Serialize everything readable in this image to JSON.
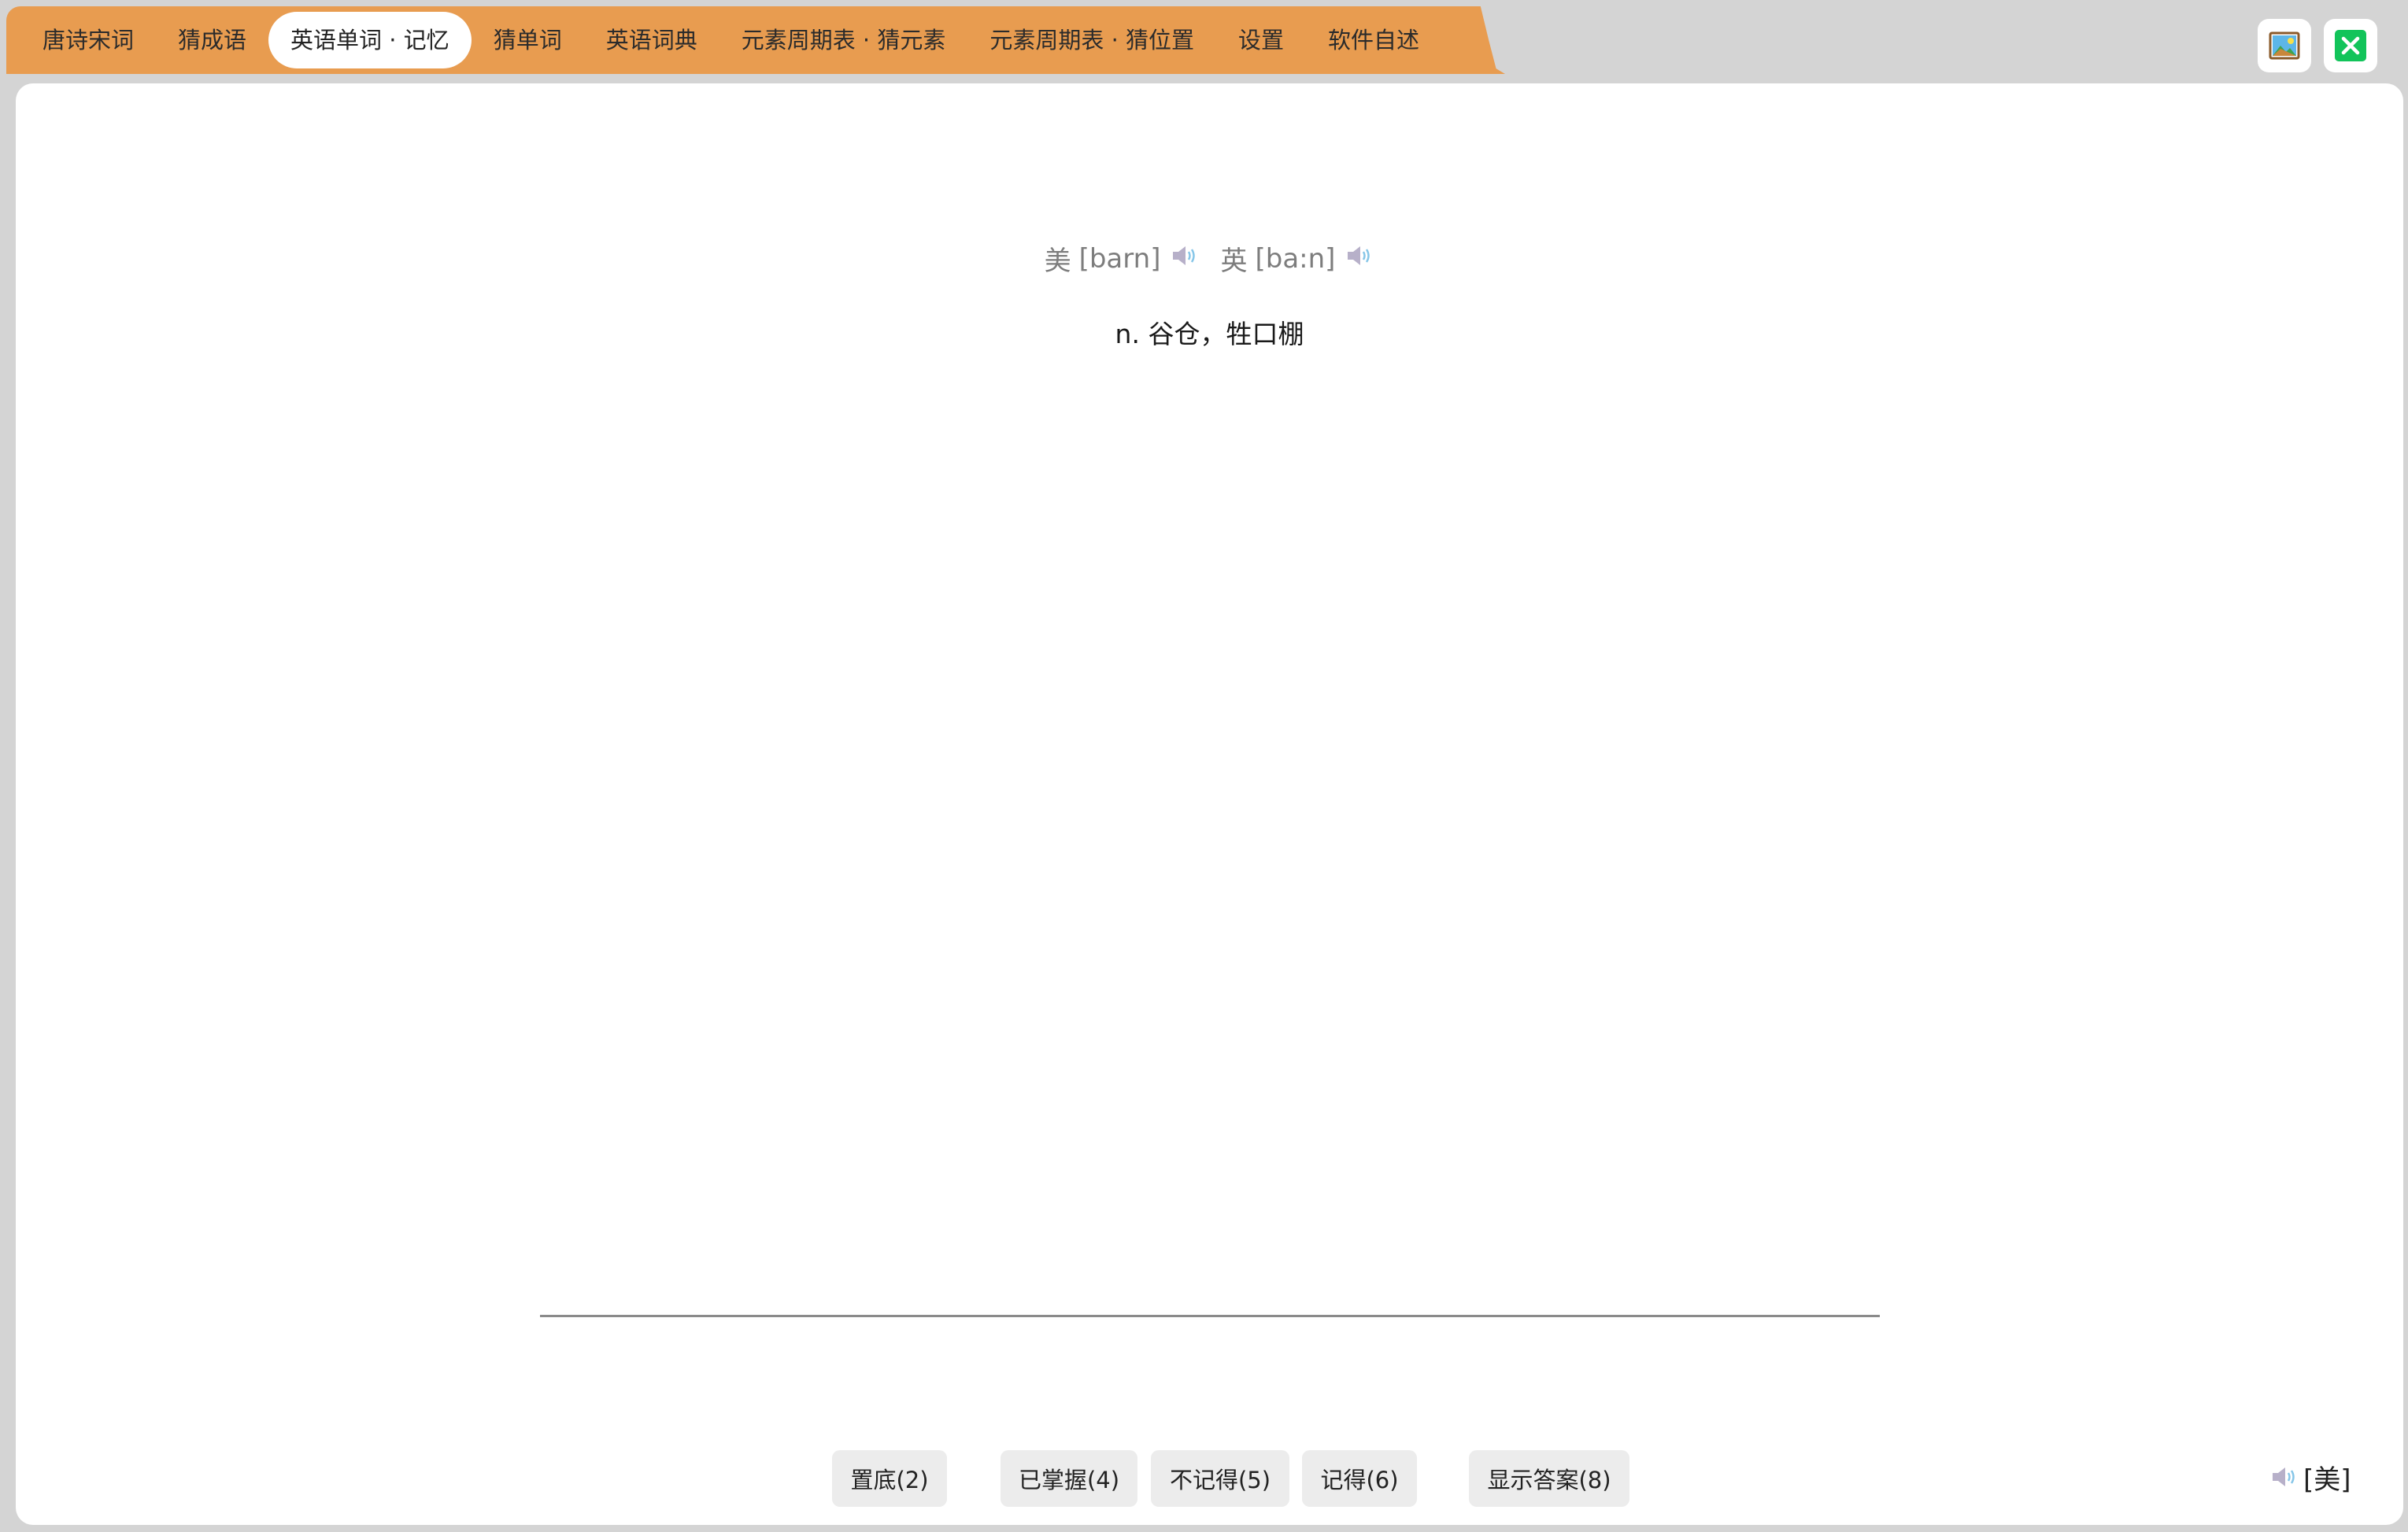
{
  "tabs": [
    {
      "label": "唐诗宋词",
      "active": false
    },
    {
      "label": "猜成语",
      "active": false
    },
    {
      "label": "英语单词 · 记忆",
      "active": true
    },
    {
      "label": "猜单词",
      "active": false
    },
    {
      "label": "英语词典",
      "active": false
    },
    {
      "label": "元素周期表 · 猜元素",
      "active": false
    },
    {
      "label": "元素周期表 · 猜位置",
      "active": false
    },
    {
      "label": "设置",
      "active": false
    },
    {
      "label": "软件自述",
      "active": false
    }
  ],
  "top_buttons": {
    "image_icon": "image-icon",
    "close_icon": "close-icon"
  },
  "word": {
    "us_label": "美",
    "us_phonetic": "[barn]",
    "uk_label": "英",
    "uk_phonetic": "[ba:n]",
    "definition": "n. 谷仓，牲口棚"
  },
  "buttons": {
    "bottom": "置底(2)",
    "mastered": "已掌握(4)",
    "forgot": "不记得(5)",
    "remembered": "记得(6)",
    "show_answer": "显示答案(8)"
  },
  "accent_setting": {
    "label": "[美]",
    "icon": "speaker-icon"
  },
  "colors": {
    "tab_bar": "#e89c50",
    "background": "#d4d4d4",
    "panel": "#ffffff",
    "button": "#ececec",
    "close_button": "#12c45a"
  }
}
